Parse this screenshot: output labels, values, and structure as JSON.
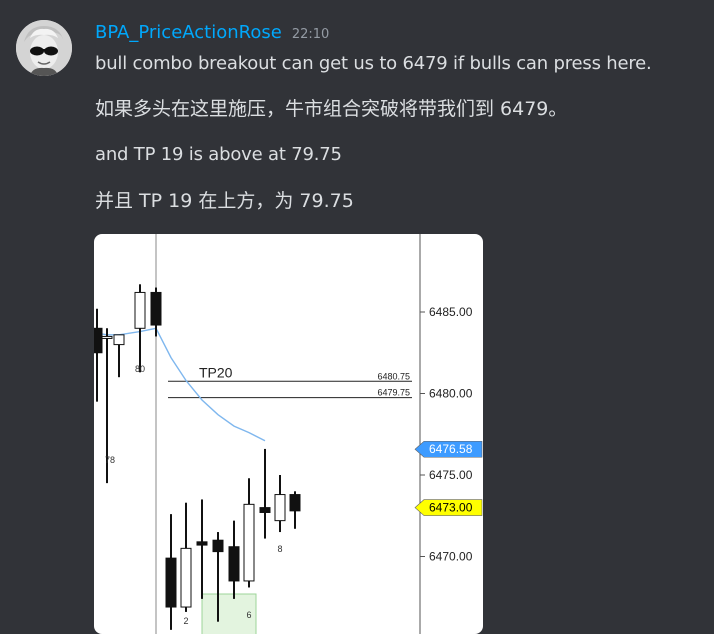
{
  "message": {
    "username": "BPA_PriceActionRose",
    "timestamp": "22:10",
    "lines": [
      "bull combo breakout can get us to 6479 if bulls can press here.",
      "如果多头在这里施压，牛市组合突破将带我们到 6479。",
      "and TP 19 is above at 79.75",
      "并且 TP 19 在上方，为 79.75"
    ]
  },
  "chart_data": {
    "type": "candlestick",
    "price_axis": {
      "ticks": [
        "6485.00",
        "6480.00",
        "6475.00",
        "6470.00"
      ],
      "tick_values": [
        6485,
        6480,
        6475,
        6470
      ],
      "range": [
        6466,
        6490
      ]
    },
    "price_tags": [
      {
        "label": "6476.58",
        "value": 6476.58,
        "color": "#3d9bff",
        "text_color": "#ffffff"
      },
      {
        "label": "6473.00",
        "value": 6473.0,
        "color": "#ffff00",
        "text_color": "#000000"
      }
    ],
    "target_lines": [
      {
        "label": "6480.75",
        "value": 6480.75
      },
      {
        "label": "6479.75",
        "value": 6479.75
      }
    ],
    "target_title": "TP20",
    "bar_labels": [
      "80",
      "78",
      "2",
      "6",
      "8"
    ],
    "ema_color": "#7fb7ee",
    "candles": [
      {
        "o": 6484.0,
        "h": 6485.2,
        "l": 6479.5,
        "c": 6482.5
      },
      {
        "o": 6483.5,
        "h": 6484.0,
        "l": 6474.5,
        "c": 6483.5
      },
      {
        "o": 6483.0,
        "h": 6483.4,
        "l": 6481.0,
        "c": 6483.6
      },
      {
        "o": 6484.0,
        "h": 6486.7,
        "l": 6481.3,
        "c": 6486.2
      },
      {
        "o": 6486.2,
        "h": 6486.5,
        "l": 6483.5,
        "c": 6484.2
      },
      {
        "o": 6469.9,
        "h": 6472.6,
        "l": 6465.5,
        "c": 6466.9
      },
      {
        "o": 6466.9,
        "h": 6473.3,
        "l": 6466.6,
        "c": 6470.5
      },
      {
        "o": 6470.9,
        "h": 6473.5,
        "l": 6467.4,
        "c": 6470.7
      },
      {
        "o": 6471.0,
        "h": 6471.5,
        "l": 6466.0,
        "c": 6470.3
      },
      {
        "o": 6470.6,
        "h": 6472.2,
        "l": 6467.4,
        "c": 6468.5
      },
      {
        "o": 6468.5,
        "h": 6474.8,
        "l": 6468.1,
        "c": 6473.2
      },
      {
        "o": 6473.0,
        "h": 6476.6,
        "l": 6471.1,
        "c": 6472.7
      },
      {
        "o": 6472.2,
        "h": 6475.0,
        "l": 6471.5,
        "c": 6473.8
      },
      {
        "o": 6473.8,
        "h": 6474.0,
        "l": 6471.7,
        "c": 6472.8
      }
    ],
    "ema": [
      6483.7,
      6483.6,
      6483.6,
      6483.8,
      6484.0,
      6482.2,
      6480.8,
      6479.6,
      6478.7,
      6478.0,
      6477.6,
      6477.1
    ]
  }
}
